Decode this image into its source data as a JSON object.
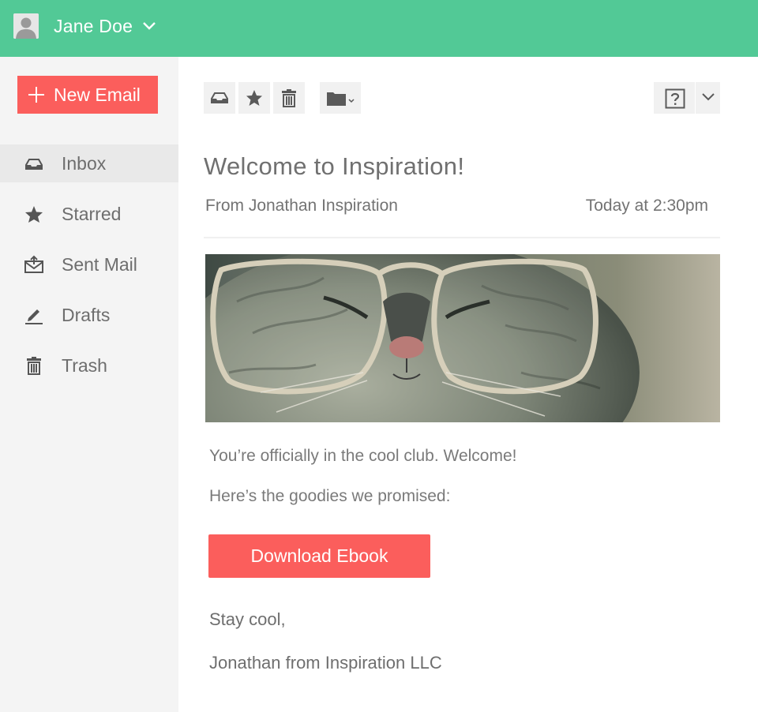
{
  "user": {
    "name": "Jane Doe"
  },
  "sidebar": {
    "new_email_label": "New Email",
    "items": [
      {
        "label": "Inbox",
        "icon": "inbox-icon",
        "active": true
      },
      {
        "label": "Starred",
        "icon": "star-icon",
        "active": false
      },
      {
        "label": "Sent Mail",
        "icon": "sent-mail-icon",
        "active": false
      },
      {
        "label": "Drafts",
        "icon": "pencil-icon",
        "active": false
      },
      {
        "label": "Trash",
        "icon": "trash-icon",
        "active": false
      }
    ]
  },
  "toolbar": {
    "buttons": [
      "inbox-icon",
      "star-icon",
      "trash-icon",
      "folder-icon",
      "help-icon",
      "chevron-down-icon"
    ]
  },
  "email": {
    "subject": "Welcome to Inspiration!",
    "from": "From Jonathan Inspiration",
    "time": "Today at 2:30pm",
    "body_line_1": "You’re officially in the cool club. Welcome!",
    "body_line_2": "Here’s the goodies we promised:",
    "cta_label": "Download Ebook",
    "signoff": "Stay cool,",
    "signature": "Jonathan from Inspiration LLC"
  },
  "colors": {
    "topbar": "#52c996",
    "accent": "#fb5e5c",
    "sidebar_bg": "#f4f4f4",
    "active_item_bg": "#e9e9e9"
  }
}
